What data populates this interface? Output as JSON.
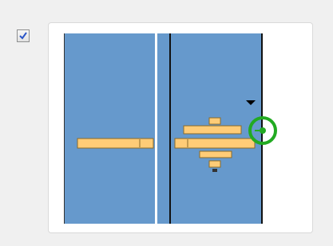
{
  "panel": {
    "enabled_checkbox": {
      "checked": true
    },
    "colors": {
      "background": "#f0f0f0",
      "card_background": "#ffffff",
      "pane_fill": "#6699cc",
      "bar_fill": "#ffcc77",
      "selector_ring": "#22aa22",
      "checkmark": "#2a55c8"
    },
    "icons": {
      "checkbox": "checkmark-icon",
      "selector": "target-circle-icon",
      "dropdown": "triangle-down-icon"
    }
  }
}
